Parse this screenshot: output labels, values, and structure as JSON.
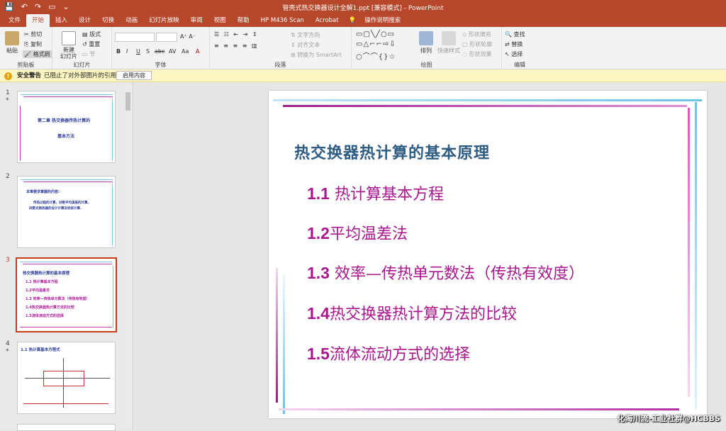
{
  "window": {
    "title": "管壳式热交换器设计全解1.ppt [兼容模式] - PowerPoint"
  },
  "tabs": [
    "文件",
    "开始",
    "插入",
    "设计",
    "切换",
    "动画",
    "幻灯片放映",
    "审阅",
    "视图",
    "帮助",
    "HP M436 Scan",
    "Acrobat"
  ],
  "tell_me": "操作说明搜索",
  "ribbon": {
    "clipboard": {
      "paste": "粘贴",
      "cut": "剪切",
      "copy": "复制",
      "format_painter": "格式刷",
      "label": "剪贴板"
    },
    "slides": {
      "new_slide": "新建\n幻灯片",
      "layout": "版式",
      "reset": "重置",
      "section": "节",
      "label": "幻灯片"
    },
    "font": {
      "label": "字体",
      "bold": "B",
      "italic": "I",
      "underline": "U",
      "shadow": "S",
      "strike": "abc",
      "spacing": "AV",
      "case": "Aa",
      "color": "A"
    },
    "paragraph": {
      "label": "段落",
      "text_direction": "文字方向",
      "align_text": "对齐文本",
      "smartart": "转换为 SmartArt"
    },
    "drawing": {
      "label": "绘图",
      "arrange": "排列",
      "quick_styles": "快速样式",
      "shape_fill": "形状填充",
      "shape_outline": "形状轮廓",
      "shape_effects": "形状效果"
    },
    "editing": {
      "label": "编辑",
      "find": "查找",
      "replace": "替换",
      "select": "选择"
    }
  },
  "security": {
    "title": "安全警告",
    "message": "已阻止了对外部图片的引用",
    "button": "启用内容"
  },
  "thumbnails": [
    {
      "num": "1",
      "star": "*",
      "title": "第二章 热交换器传热计算的",
      "subtitle": "基本方法"
    },
    {
      "num": "2",
      "star": "",
      "heading": "本章要求掌握的内容:",
      "body": "传热过程的计算，对数平均温差的计算,",
      "body2": "间壁式换热器的设计计算及校核计算."
    },
    {
      "num": "3",
      "star": "",
      "title": "热交换器热计算的基本原理",
      "items": [
        "1.1 热计算基本方程",
        "1.2平均温差法",
        "1.3 效率—传热单元数法（传热有效度）",
        "1.4热交换器热计算方法的比较",
        "1.5流体流动方式的选择"
      ]
    },
    {
      "num": "4",
      "star": "*",
      "title": "1.1 热计算基本方程式"
    }
  ],
  "slide": {
    "title": "热交换器热计算的基本原理",
    "items": [
      {
        "num": "1.1",
        "text": " 热计算基本方程"
      },
      {
        "num": "1.2",
        "text": "平均温差法"
      },
      {
        "num": "1.3",
        "text": " 效率—传热单元数法（传热有效度）"
      },
      {
        "num": "1.4",
        "text": "热交换器热计算方法的比较"
      },
      {
        "num": "1.5",
        "text": "流体流动方式的选择"
      }
    ]
  },
  "watermark": "化海川流-工业社群@HCBBS",
  "colors": {
    "accent": "#b7472a",
    "slide_title": "#2e5c83",
    "slide_item": "#a8178e",
    "selected_thumb": "#c43e1c"
  }
}
